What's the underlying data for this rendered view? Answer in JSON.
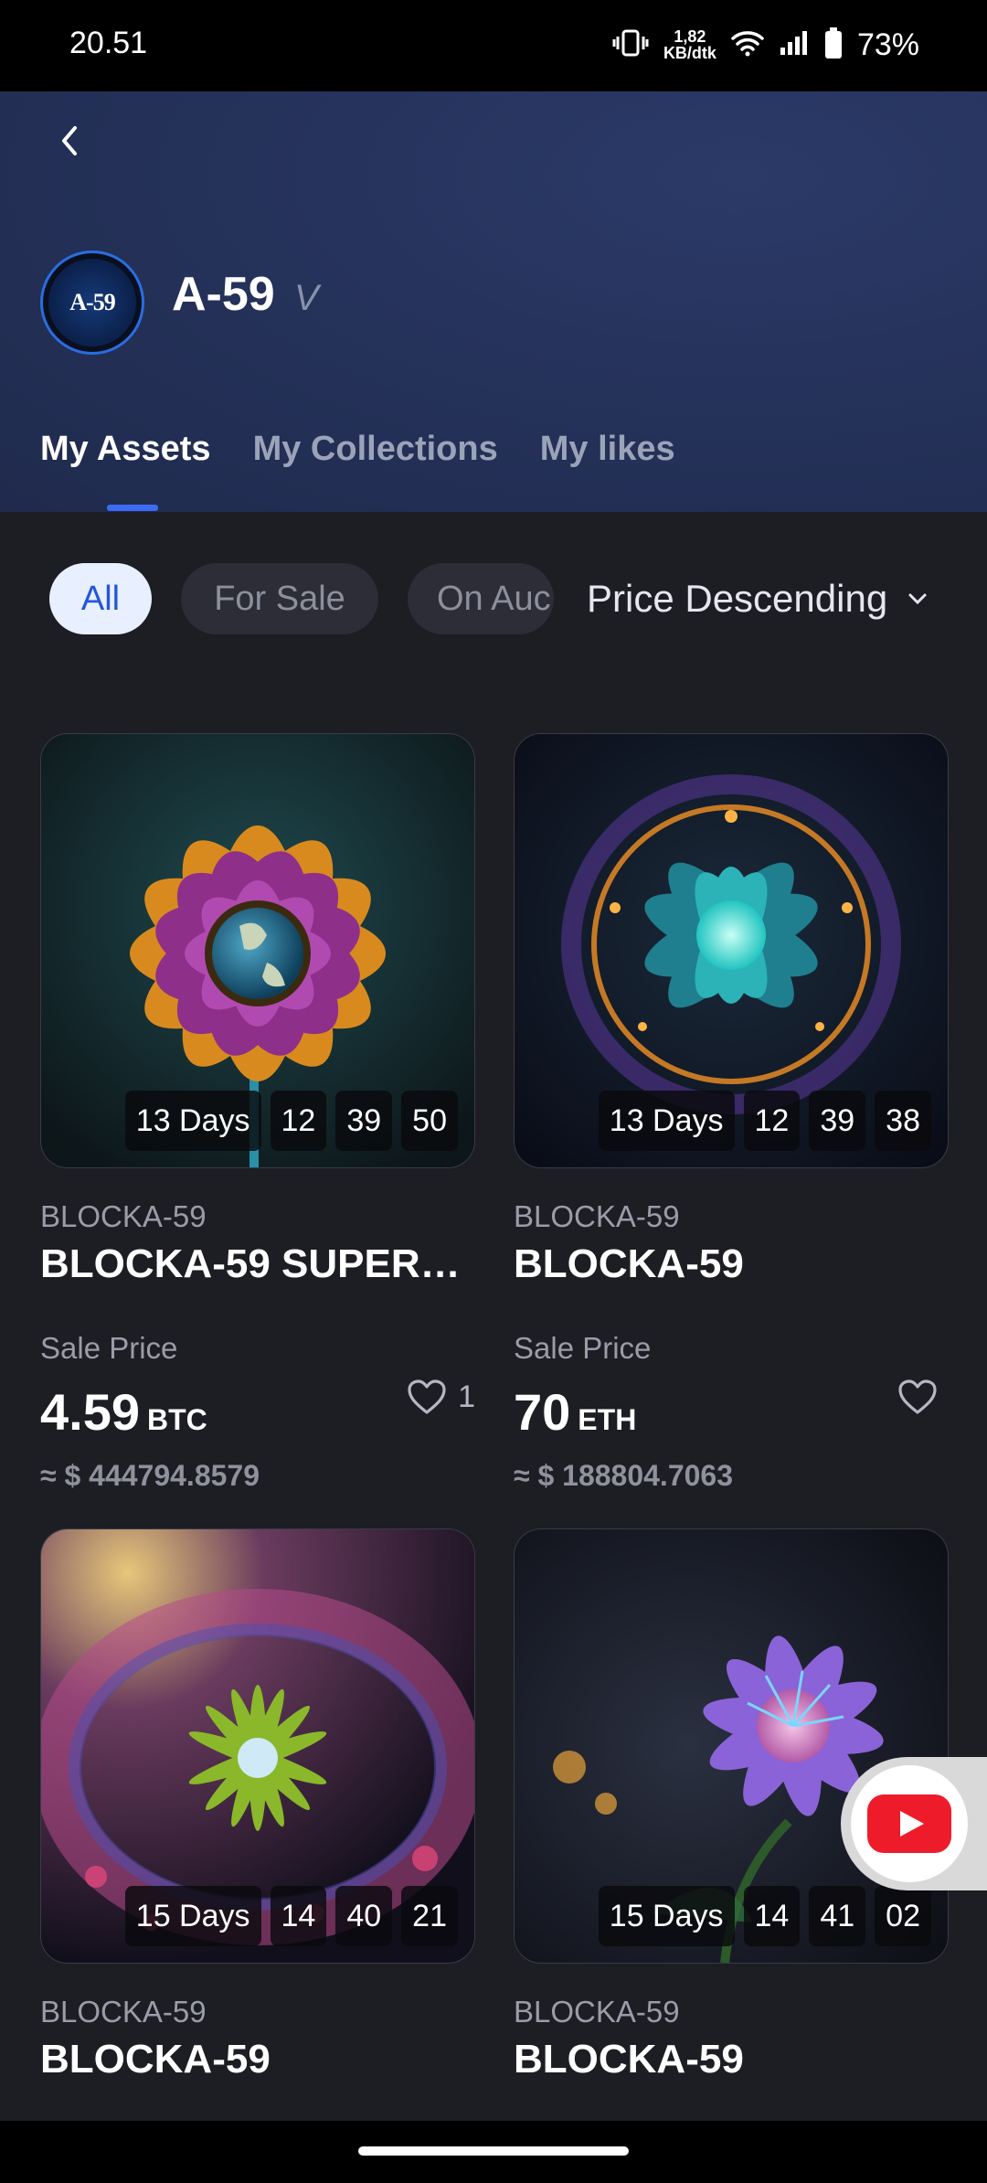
{
  "status_bar": {
    "time": "20.51",
    "net_speed_value": "1,82",
    "net_speed_unit": "KB/dtk",
    "battery": "73%"
  },
  "profile": {
    "avatar_text": "A-59",
    "username": "A-59",
    "verified_mark": "V"
  },
  "tabs": [
    {
      "label": "My Assets",
      "active": true
    },
    {
      "label": "My Collections",
      "active": false
    },
    {
      "label": "My likes",
      "active": false
    }
  ],
  "filters": {
    "chips": [
      {
        "label": "All",
        "selected": true
      },
      {
        "label": "For Sale",
        "selected": false
      },
      {
        "label": "On Auc",
        "selected": false
      }
    ],
    "sort": "Price Descending"
  },
  "cards": [
    {
      "collection": "BLOCKA-59",
      "name": "BLOCKA-59 SUPERA...",
      "timer": {
        "days": "13 Days",
        "h": "12",
        "m": "39",
        "s": "50"
      },
      "price_label": "Sale Price",
      "price": "4.59",
      "currency": "BTC",
      "usd": "≈ $ 444794.8579",
      "likes": "1"
    },
    {
      "collection": "BLOCKA-59",
      "name": "BLOCKA-59",
      "timer": {
        "days": "13 Days",
        "h": "12",
        "m": "39",
        "s": "38"
      },
      "price_label": "Sale Price",
      "price": "70",
      "currency": "ETH",
      "usd": "≈ $ 188804.7063",
      "likes": ""
    },
    {
      "collection": "BLOCKA-59",
      "name": "BLOCKA-59",
      "timer": {
        "days": "15 Days",
        "h": "14",
        "m": "40",
        "s": "21"
      }
    },
    {
      "collection": "BLOCKA-59",
      "name": "BLOCKA-59",
      "timer": {
        "days": "15 Days",
        "h": "14",
        "m": "41",
        "s": "02"
      }
    }
  ],
  "colors": {
    "accent": "#3b6bf0",
    "background": "#1d1d24",
    "header": "#26335c"
  }
}
